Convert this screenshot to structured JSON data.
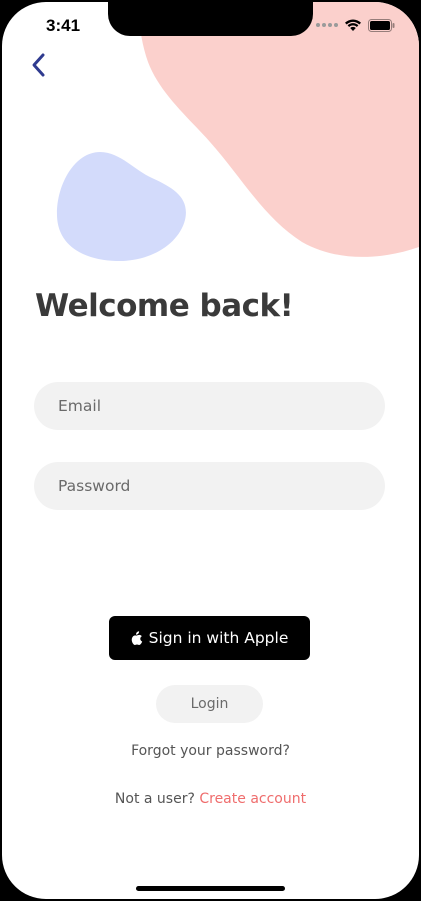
{
  "status_bar": {
    "time": "3:41"
  },
  "colors": {
    "pink_blob": "#fbd0cc",
    "blue_blob": "#d3dbfb",
    "title": "#3a3a3a",
    "field_bg": "#f2f2f2",
    "link_accent": "#ef6d6d",
    "back_chevron": "#2f3b8f"
  },
  "icons": {
    "back": "chevron-left-icon",
    "apple": "apple-logo-icon",
    "wifi": "wifi-icon",
    "battery": "battery-icon",
    "signal": "cellular-signal-icon"
  },
  "page": {
    "title": "Welcome back!"
  },
  "form": {
    "email": {
      "value": "",
      "placeholder": "Email"
    },
    "password": {
      "value": "",
      "placeholder": "Password"
    }
  },
  "actions": {
    "apple_label": "Sign in with Apple",
    "login_label": "Login",
    "forgot_label": "Forgot your password?"
  },
  "signup": {
    "prompt": "Not a user?",
    "link": "Create account"
  }
}
